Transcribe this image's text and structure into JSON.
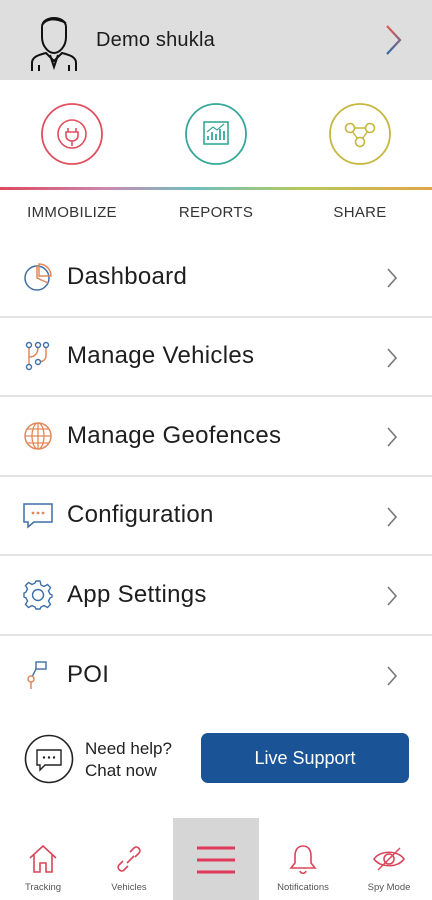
{
  "header": {
    "user_name": "Demo shukla"
  },
  "quick_actions": [
    {
      "label": "IMMOBILIZE",
      "icon": "immobilize-plug-icon",
      "color": "#e04f5f"
    },
    {
      "label": "REPORTS",
      "icon": "reports-chart-icon",
      "color": "#35a89a"
    },
    {
      "label": "SHARE",
      "icon": "share-icon",
      "color": "#c6b73d"
    }
  ],
  "menu": [
    {
      "label": "Dashboard",
      "icon": "pie-chart-icon"
    },
    {
      "label": "Manage Vehicles",
      "icon": "branch-icon"
    },
    {
      "label": "Manage Geofences",
      "icon": "globe-icon"
    },
    {
      "label": "Configuration",
      "icon": "chat-bubble-icon"
    },
    {
      "label": "App Settings",
      "icon": "gear-icon"
    },
    {
      "label": "POI",
      "icon": "poi-pin-icon"
    }
  ],
  "help": {
    "line1": "Need help?",
    "line2": "Chat now",
    "button": "Live Support"
  },
  "bottom_nav": [
    {
      "label": "Tracking",
      "icon": "home-icon"
    },
    {
      "label": "Vehicles",
      "icon": "link-icon"
    },
    {
      "label": "",
      "icon": "hamburger-menu-icon",
      "active": true
    },
    {
      "label": "Notifications",
      "icon": "bell-icon"
    },
    {
      "label": "Spy Mode",
      "icon": "eye-icon"
    }
  ],
  "colors": {
    "accent": "#1b5496",
    "icon_orange": "#e0885a",
    "icon_blue": "#3f6fa6",
    "nav_red": "#d9465a"
  }
}
